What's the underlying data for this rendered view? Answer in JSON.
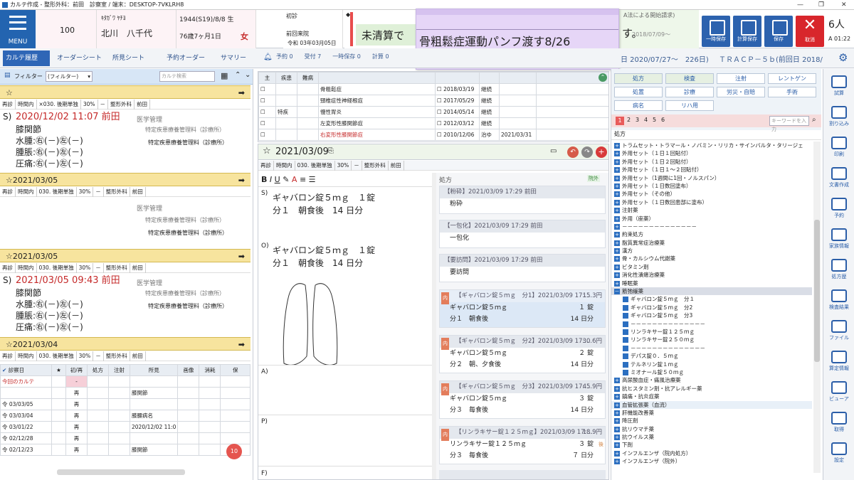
{
  "titlebar": {
    "text": "カルテ作成 - 整形外科：前田　診察室 / 端末：DESKTOP-7VKLRH8"
  },
  "header": {
    "menu": "MENU",
    "patient_no": "100",
    "kana": "ｷﾀｶﾞﾜ ﾔﾁﾖ",
    "name": "北川　八千代",
    "dob": "1944(S19)/8/8 生",
    "age": "76歳7ヶ月1日",
    "sex": "女",
    "visit_type": "初診",
    "prev_visit_label": "前回来院",
    "prev_visit_date": "令和 03年03月05日",
    "warning": "未清算で",
    "warning_tail": "す。",
    "right_top": "A法による開始請求)",
    "right_date": "2018/07/09〜",
    "btn_save1": "一時保存",
    "btn_save2": "計算保存",
    "btn_save3": "保存",
    "btn_cancel": "取消",
    "people": "6人",
    "people_sub": "A 01:22"
  },
  "sticky": {
    "text": "骨粗鬆症運動パンフ渡す8/26"
  },
  "nav": {
    "tabs": [
      "カルテ履歴",
      "オーダーシート",
      "所見シート",
      "予約オーダー",
      "サマリー"
    ],
    "counts": "予約 0　　受付 7　　一時保存 0　　計算 0",
    "date_range": "日 2020/07/27〜　226日)",
    "tracp": "ＴＲＡＣＰ－５ｂ(前回日 2018/"
  },
  "left": {
    "filter_label": "フィルター",
    "filter_value": "(フィルター)",
    "search_placeholder": "カルテ検索",
    "subrow_cols": [
      "再診",
      "時間内",
      "×030. 後期単独",
      "30%",
      "－",
      "整形外科",
      "前田"
    ],
    "subrow_cols2": [
      "再診",
      "時間内",
      "030. 後期単独",
      "30%",
      "－",
      "整形外科",
      "前田"
    ],
    "entry1_title": "2020/12/02 11:07 前田",
    "entry1_lines": [
      "膝関節",
      "水腫:㊨(－)㊧(－)",
      "腫脹:㊨(－)㊧(－)",
      "圧痛:㊨(－)㊧(－)"
    ],
    "mgmt": "医学管理",
    "mgmt_detail1": "特定疾患療養管理料（診療所）",
    "mgmt_detail2": "特定疾患療養管理料（診療所）",
    "date2": "2021/03/05",
    "date3": "2021/03/05",
    "entry3_title": "2021/03/05 09:43 前田",
    "entry3_lines": [
      "膝関節",
      "水腫:㊨(－)㊧(－)",
      "腫脹:㊨(－)㊧(－)",
      "圧痛:㊨(－)㊧(－)"
    ],
    "date4": "2021/03/04",
    "hist_headers": [
      "診察日",
      "★",
      "初/再",
      "処方",
      "注射",
      "所見",
      "画像",
      "消耗",
      "保"
    ],
    "hist_rows": [
      [
        "今回のカルテ",
        "",
        "-",
        "",
        "",
        "",
        "",
        ""
      ],
      [
        "",
        "",
        "再",
        "",
        "",
        "膝関節",
        "",
        ""
      ],
      [
        "令 03/03/05",
        "",
        "再",
        "",
        "",
        "",
        "",
        ""
      ],
      [
        "令 03/03/04",
        "",
        "再",
        "",
        "",
        "膝腰病名",
        "",
        ""
      ],
      [
        "令 03/01/22",
        "",
        "再",
        "",
        "",
        "2020/12/02 11:0",
        "",
        ""
      ],
      [
        "令 02/12/28",
        "",
        "再",
        "",
        "",
        "",
        "",
        ""
      ],
      [
        "令 02/12/23",
        "",
        "再",
        "",
        "",
        "膝関節",
        "",
        ""
      ]
    ],
    "badge": "10"
  },
  "disease": {
    "headers": [
      "主",
      "疾患",
      "難病",
      "",
      "",
      "",
      "",
      ""
    ],
    "rows": [
      [
        "",
        "",
        "",
        "骨粗鬆症",
        "2018/03/19",
        "継続",
        ""
      ],
      [
        "",
        "",
        "",
        "頸椎症性神経根症",
        "2017/05/29",
        "継続",
        ""
      ],
      [
        "",
        "特疾",
        "",
        "慢性胃炎",
        "2014/05/14",
        "継続",
        ""
      ],
      [
        "",
        "",
        "",
        "左変形性膝関節症",
        "2012/03/12",
        "継続",
        ""
      ],
      [
        "",
        "",
        "",
        "右変形性膝関節症",
        "2010/12/06",
        "治ゆ",
        "2021/03/31"
      ]
    ]
  },
  "editor": {
    "date": "2021/03/09",
    "sub": [
      "再診",
      "時間内",
      "030. 後期単独",
      "30%",
      "－",
      "整形外科",
      "前田"
    ],
    "S_label": "S)",
    "S_lines": [
      "ギャバロン錠５ｍｇ　１錠",
      "分１　朝食後　14 日分"
    ],
    "O_label": "O)",
    "O_lines": [
      "ギャバロン錠５ｍｇ　１錠",
      "分１　朝食後　14 日分"
    ],
    "A_label": "A)",
    "P_label": "P)",
    "F_label": "F)"
  },
  "rx": {
    "header": "処方",
    "inhouse": "院外",
    "blocks": [
      {
        "h": "【粉砕】2021/03/09 17:29 前田",
        "body": "粉砕"
      },
      {
        "h": "【一包化】2021/03/09 17:29 前田",
        "body": "一包化"
      },
      {
        "h": "【要訪問】2021/03/09 17:29 前田",
        "body": "要訪問"
      }
    ],
    "meds": [
      {
        "h": "【ギャバロン錠５ｍｇ　分1】2021/03/09 17:...",
        "pts": "15.3円",
        "drug": "ギャバロン錠５ｍｇ",
        "qty": "１ 錠",
        "usage": "分１　朝食後",
        "days": "14 日分"
      },
      {
        "h": "【ギャバロン錠５ｍｇ　分2】2021/03/09 17:...",
        "pts": "30.6円",
        "drug": "ギャバロン錠５ｍｇ",
        "qty": "２ 錠",
        "usage": "分２　朝、夕食後",
        "days": "14 日分"
      },
      {
        "h": "【ギャバロン錠５ｍｇ　分3】2021/03/09 17:...",
        "pts": "45.9円",
        "drug": "ギャバロン錠５ｍｇ",
        "qty": "３ 錠",
        "usage": "分３　毎食後",
        "days": "14 日分"
      },
      {
        "h": "【リンラキサー錠１２５ｍｇ】2021/03/09 17:...",
        "pts": "18.9円",
        "drug": "リンラキサー錠１２５ｍｇ",
        "qty": "３ 錠",
        "usage": "分３　毎食後",
        "days": "７ 日分"
      }
    ],
    "in_tag": "内",
    "kou_tag": "後"
  },
  "order": {
    "row1": [
      "処方",
      "検査",
      "注射",
      "レントゲン"
    ],
    "row2": [
      "処置",
      "診療",
      "労災・自賠",
      "手術"
    ],
    "row3": [
      "病名",
      "リハ用"
    ],
    "pages": [
      "1",
      "2",
      "3",
      "4",
      "5",
      "6"
    ],
    "keyword_placeholder": "キーワードを入力",
    "tree_title": "処方",
    "tree": [
      "トラムセット・トラマール・ノバミン・リリカ・サインバルタ・タリージェ",
      "外用セット（１日１回貼付）",
      "外用セット（１日２回貼付）",
      "外用セット（１日１～２回貼付）",
      "外用セット（1週間に1回・ノルスパン）",
      "外用セット（１日数回塗布）",
      "外用セット（その他）",
      "外用セット（１日数回患部に塗布）",
      "注射薬",
      "外用（座薬）",
      "－－－－－－－－－－－－－－",
      "約束処方",
      "脂質異常症治療薬",
      "漢方",
      "骨・カルシウム代謝薬",
      "ビタミン剤",
      "消化性潰瘍治療薬",
      "睡眠薬",
      "筋弛緩薬",
      "ギャバロン錠５ｍｇ　分１",
      "ギャバロン錠５ｍｇ　分2",
      "ギャバロン錠５ｍｇ　分3",
      "－－－－－－－－－－－－－－",
      "リンラキサー錠１２５ｍｇ",
      "リンラキサー錠２５０ｍｇ",
      "－－－－－－－－－－－－－－",
      "デパス錠０．５ｍｇ",
      "テルネリン錠１ｍｇ",
      "ミオナール錠５０ｍｇ",
      "高尿酸血症・痛風治療薬",
      "抗ヒスタミン剤・抗アレルギー薬",
      "鎮痛・抗炎症薬",
      "血管拡張薬（血流）",
      "肝機能改善薬",
      "降圧剤",
      "抗リウマチ薬",
      "抗ウイルス薬",
      "下剤",
      "インフルエンザ（院内処方）",
      "インフルエンザ（院外）"
    ]
  },
  "sidebar": [
    "試算",
    "割り込み",
    "印刷",
    "文書作成",
    "予約",
    "家族情報",
    "処方歴",
    "検査結果",
    "ファイル",
    "算定情報",
    "ビューア",
    "取得",
    "設定"
  ],
  "colors": {
    "accent": "#2364b0",
    "red": "#c52a2a",
    "yellow": "#f7e49e",
    "sticky": "#e6d6f7"
  }
}
